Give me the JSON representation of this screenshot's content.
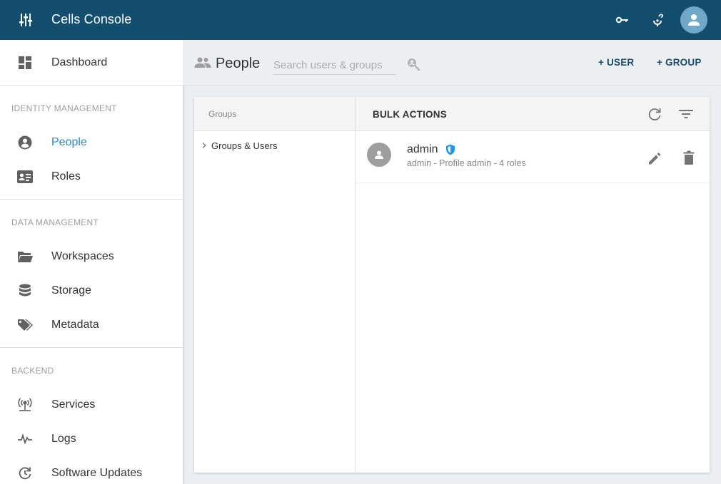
{
  "app": {
    "title": "Cells Console"
  },
  "topbar": {
    "menu_icon": "settings-sliders-icon",
    "key_icon": "key-icon",
    "help_icon": "help-icon",
    "avatar_icon": "user-avatar-icon"
  },
  "sidebar": {
    "dashboard": "Dashboard",
    "sections": [
      {
        "title": "IDENTITY MANAGEMENT",
        "items": [
          {
            "label": "People",
            "icon": "account-circle-icon",
            "active": true
          },
          {
            "label": "Roles",
            "icon": "id-card-icon"
          }
        ]
      },
      {
        "title": "DATA MANAGEMENT",
        "items": [
          {
            "label": "Workspaces",
            "icon": "folder-open-icon"
          },
          {
            "label": "Storage",
            "icon": "database-icon"
          },
          {
            "label": "Metadata",
            "icon": "tags-icon"
          }
        ]
      },
      {
        "title": "BACKEND",
        "items": [
          {
            "label": "Services",
            "icon": "access-point-icon"
          },
          {
            "label": "Logs",
            "icon": "pulse-icon"
          },
          {
            "label": "Software Updates",
            "icon": "update-icon"
          }
        ]
      }
    ]
  },
  "header": {
    "title": "People",
    "search_placeholder": "Search users & groups",
    "add_user": "+ USER",
    "add_group": "+ GROUP"
  },
  "groups": {
    "header": "Groups",
    "tree_root": "Groups & Users"
  },
  "users": {
    "bulk_label": "BULK ACTIONS",
    "rows": [
      {
        "name": "admin",
        "detail": "admin - Profile admin - 4 roles",
        "badge": "admin-shield-icon"
      }
    ]
  },
  "colors": {
    "topbar": "#134e6f",
    "accent": "#2e8bc0",
    "shield": "#2196f3"
  }
}
